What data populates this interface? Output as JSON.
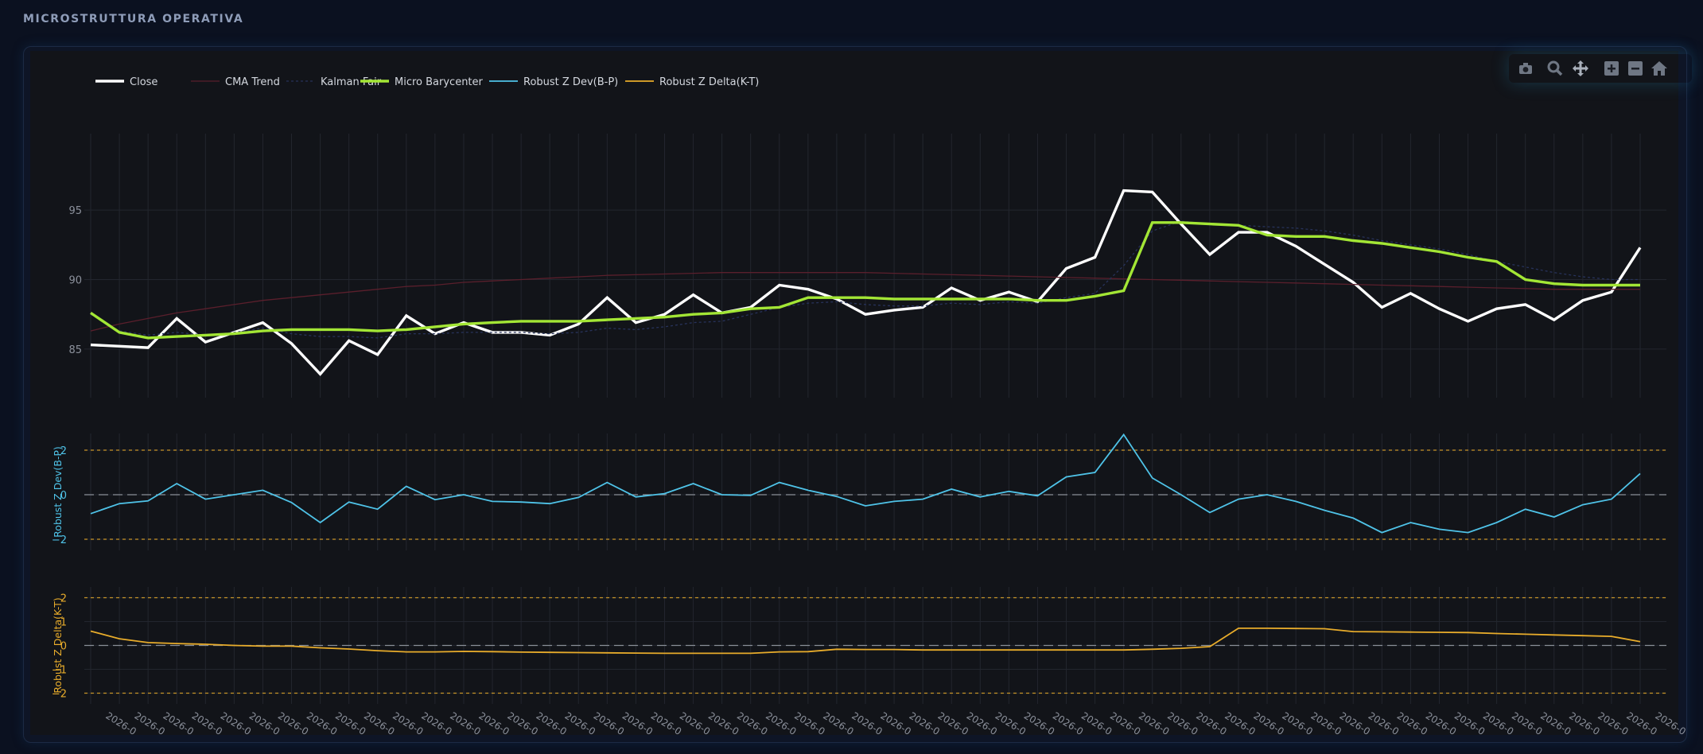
{
  "page": {
    "section_title": "MICROSTRUTTURA OPERATIVA"
  },
  "modebar": {
    "icons": [
      "camera-icon",
      "zoom-icon",
      "pan-icon",
      "zoom-in-icon",
      "zoom-out-icon",
      "home-icon"
    ]
  },
  "colors": {
    "background": "#0b1120",
    "plot_bg": "#121419",
    "close": "#ffffff",
    "cma": "#5a1f2c",
    "kalman": "#27325a",
    "barycenter": "#a3e635",
    "z_dev": "#4fc3e8",
    "z_delta": "#e8ac2b",
    "threshold": "#c8952a",
    "zero": "#8a8f98",
    "grid": "#23262e",
    "tick_text": "#8c919c"
  },
  "chart_data": {
    "type": "line",
    "legend": {
      "placement": "top-left",
      "items": [
        {
          "label": "Close",
          "series": "close"
        },
        {
          "label": "CMA Trend",
          "series": "cma"
        },
        {
          "label": "Kalman Fair",
          "series": "kalman"
        },
        {
          "label": "Micro Barycenter",
          "series": "barycenter"
        },
        {
          "label": "Robust Z Dev(B-P)",
          "series": "z_dev"
        },
        {
          "label": "Robust Z Delta(K-T)",
          "series": "z_delta"
        }
      ]
    },
    "grid": true,
    "x_tick_labels": [
      "2026-0",
      "2026-0",
      "2026-0",
      "2026-0",
      "2026-0",
      "2026-0",
      "2026-0",
      "2026-0",
      "2026-0",
      "2026-0",
      "2026-0",
      "2026-0",
      "2026-0",
      "2026-0",
      "2026-0",
      "2026-0",
      "2026-0",
      "2026-0",
      "2026-0",
      "2026-0",
      "2026-0",
      "2026-0",
      "2026-0",
      "2026-0",
      "2026-0",
      "2026-0",
      "2026-0",
      "2026-0",
      "2026-0",
      "2026-0",
      "2026-0",
      "2026-0",
      "2026-0",
      "2026-0",
      "2026-0",
      "2026-0",
      "2026-0",
      "2026-0",
      "2026-0",
      "2026-0",
      "2026-0",
      "2026-0",
      "2026-0",
      "2026-0",
      "2026-0",
      "2026-0",
      "2026-0",
      "2026-0",
      "2026-0",
      "2026-0",
      "2026-0",
      "2026-0",
      "2026-0",
      "2026-0",
      "2026-0"
    ],
    "panels": [
      {
        "id": "price",
        "ylabel": "",
        "ylim": [
          81.5,
          100.5
        ],
        "yticks": [
          85,
          90,
          95
        ],
        "series": [
          {
            "name": "Close",
            "key": "close",
            "values": [
              85.3,
              85.2,
              85.1,
              87.2,
              85.5,
              86.2,
              86.9,
              85.4,
              83.2,
              85.6,
              84.6,
              87.4,
              86.1,
              86.9,
              86.2,
              86.2,
              86.0,
              86.8,
              88.7,
              86.9,
              87.5,
              88.9,
              87.6,
              88.0,
              89.6,
              89.3,
              88.6,
              87.5,
              87.8,
              88.0,
              89.4,
              88.5,
              89.1,
              88.4,
              90.8,
              91.6,
              96.4,
              96.3,
              94.0,
              91.8,
              93.4,
              93.4,
              92.4,
              91.1,
              89.8,
              88.0,
              89.0,
              87.9,
              87.0,
              87.9,
              88.2,
              87.1,
              88.5,
              89.1,
              92.3
            ]
          },
          {
            "name": "CMA Trend",
            "key": "cma",
            "values": [
              86.3,
              86.8,
              87.2,
              87.6,
              87.9,
              88.2,
              88.5,
              88.7,
              88.9,
              89.1,
              89.3,
              89.5,
              89.6,
              89.8,
              89.9,
              90.0,
              90.1,
              90.2,
              90.3,
              90.35,
              90.4,
              90.45,
              90.5,
              90.5,
              90.5,
              90.5,
              90.5,
              90.5,
              90.45,
              90.4,
              90.35,
              90.3,
              90.25,
              90.2,
              90.15,
              90.1,
              90.05,
              90.0,
              89.95,
              89.9,
              89.85,
              89.8,
              89.75,
              89.7,
              89.65,
              89.6,
              89.55,
              89.5,
              89.45,
              89.4,
              89.35,
              89.3,
              89.3,
              89.3,
              89.3
            ]
          },
          {
            "name": "Kalman Fair",
            "key": "kalman",
            "values": [
              87.5,
              86.3,
              86.0,
              86.2,
              86.0,
              86.2,
              86.5,
              86.1,
              85.9,
              85.9,
              85.8,
              86.1,
              86.1,
              86.2,
              86.2,
              86.2,
              86.1,
              86.2,
              86.5,
              86.4,
              86.6,
              86.9,
              87.0,
              87.5,
              88.0,
              88.3,
              88.4,
              88.2,
              88.1,
              88.1,
              88.3,
              88.2,
              88.4,
              88.3,
              88.7,
              89.0,
              91.0,
              93.5,
              94.2,
              94.0,
              93.9,
              93.8,
              93.7,
              93.5,
              93.2,
              92.8,
              92.5,
              92.2,
              91.8,
              91.3,
              90.9,
              90.5,
              90.2,
              90.0,
              90.0
            ]
          },
          {
            "name": "Micro Barycenter",
            "key": "barycenter",
            "values": [
              87.6,
              86.2,
              85.8,
              85.9,
              86.0,
              86.1,
              86.3,
              86.4,
              86.4,
              86.4,
              86.3,
              86.4,
              86.6,
              86.8,
              86.9,
              87.0,
              87.0,
              87.0,
              87.1,
              87.2,
              87.3,
              87.5,
              87.6,
              87.9,
              88.0,
              88.7,
              88.7,
              88.7,
              88.6,
              88.6,
              88.6,
              88.6,
              88.6,
              88.5,
              88.5,
              88.8,
              89.2,
              94.1,
              94.1,
              94.0,
              93.9,
              93.2,
              93.1,
              93.1,
              92.8,
              92.6,
              92.3,
              92.0,
              91.6,
              91.3,
              90.0,
              89.7,
              89.6,
              89.6,
              89.6
            ]
          }
        ]
      },
      {
        "id": "zdev",
        "ylabel": "Robust Z Dev(B-P)",
        "ylim": [
          -2.5,
          2.75
        ],
        "yticks": [
          -2,
          0,
          2
        ],
        "thresholds": [
          2,
          -2
        ],
        "series": [
          {
            "name": "Robust Z Dev(B-P)",
            "key": "z_dev",
            "values": [
              -0.85,
              -0.4,
              -0.28,
              0.5,
              -0.2,
              0.0,
              0.2,
              -0.35,
              -1.25,
              -0.33,
              -0.65,
              0.38,
              -0.22,
              0.0,
              -0.3,
              -0.33,
              -0.4,
              -0.12,
              0.55,
              -0.1,
              0.05,
              0.5,
              0.0,
              -0.03,
              0.55,
              0.2,
              -0.08,
              -0.5,
              -0.3,
              -0.2,
              0.25,
              -0.1,
              0.15,
              -0.05,
              0.8,
              1.0,
              2.7,
              0.75,
              0.0,
              -0.8,
              -0.2,
              0.0,
              -0.3,
              -0.7,
              -1.05,
              -1.7,
              -1.25,
              -1.55,
              -1.7,
              -1.25,
              -0.65,
              -1.0,
              -0.45,
              -0.2,
              0.95
            ]
          }
        ]
      },
      {
        "id": "zdelta",
        "ylabel": "Robust Z Delta(K-T)",
        "ylim": [
          -2.45,
          2.45
        ],
        "yticks": [
          -2,
          -1,
          0,
          1,
          2
        ],
        "thresholds": [
          2,
          -2
        ],
        "series": [
          {
            "name": "Robust Z Delta(K-T)",
            "key": "z_delta",
            "values": [
              0.6,
              0.28,
              0.12,
              0.08,
              0.05,
              0.0,
              -0.03,
              -0.03,
              -0.1,
              -0.15,
              -0.22,
              -0.27,
              -0.27,
              -0.25,
              -0.26,
              -0.28,
              -0.29,
              -0.3,
              -0.31,
              -0.32,
              -0.33,
              -0.33,
              -0.33,
              -0.33,
              -0.27,
              -0.26,
              -0.16,
              -0.17,
              -0.17,
              -0.19,
              -0.19,
              -0.19,
              -0.19,
              -0.19,
              -0.19,
              -0.19,
              -0.19,
              -0.16,
              -0.12,
              -0.05,
              0.72,
              0.72,
              0.71,
              0.7,
              0.58,
              0.57,
              0.56,
              0.55,
              0.54,
              0.5,
              0.47,
              0.44,
              0.41,
              0.38,
              0.16
            ]
          }
        ]
      }
    ]
  }
}
